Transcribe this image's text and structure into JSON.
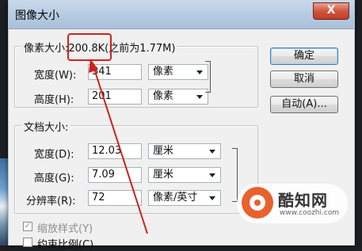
{
  "dialog": {
    "title": "图像大小",
    "close_glyph": "X"
  },
  "pixel_dimensions": {
    "group_label_prefix": "像素大小:",
    "size_value": "200.8K",
    "size_before": "(之前为1.77M)",
    "width_label": "宽度(W):",
    "width_value": "341",
    "width_unit": "像素",
    "height_label": "高度(H):",
    "height_value": "201",
    "height_unit": "像素"
  },
  "document_size": {
    "group_label": "文档大小:",
    "width_label": "宽度(D):",
    "width_value": "12.03",
    "width_unit": "厘米",
    "height_label": "高度(G):",
    "height_value": "7.09",
    "height_unit": "厘米",
    "resolution_label": "分辨率(R):",
    "resolution_value": "72",
    "resolution_unit": "像素/英寸"
  },
  "buttons": {
    "ok": "确定",
    "cancel": "取消",
    "auto": "自动(A)..."
  },
  "options": {
    "scale_styles": "缩放样式(Y)",
    "constrain_proportions": "约束比例(C)"
  },
  "watermark": {
    "name": "酷知网",
    "url": "www.coozhi.com"
  },
  "colors": {
    "annotation": "#d0211c",
    "title_bar": "#b6cbe1",
    "dialog_bg": "#f0f0f0"
  }
}
